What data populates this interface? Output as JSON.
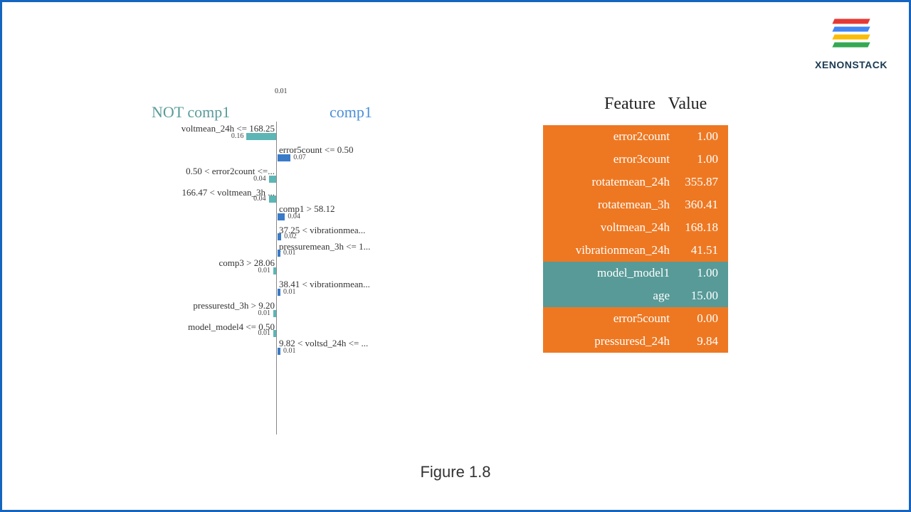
{
  "brand": "XENONSTACK",
  "caption": "Figure 1.8",
  "lime": {
    "tick_top": "0.01",
    "class_not": "NOT comp1",
    "class_yes": "comp1",
    "scale": 260,
    "bars": [
      {
        "side": "left",
        "label": "voltmean_24h <= 168.25",
        "value": 0.16,
        "text": "0.16"
      },
      {
        "side": "right",
        "label": "error5count <= 0.50",
        "value": 0.07,
        "text": "0.07"
      },
      {
        "side": "left",
        "label": "0.50 < error2count <=...",
        "value": 0.04,
        "text": "0.04"
      },
      {
        "side": "left",
        "label": "166.47 < voltmean_3h ...",
        "value": 0.04,
        "text": "0.04",
        "compact": true
      },
      {
        "side": "right",
        "label": "comp1 > 58.12",
        "value": 0.04,
        "text": "0.04"
      },
      {
        "side": "right",
        "label": "37.25 < vibrationmea...",
        "value": 0.02,
        "text": "0.02",
        "compact": true
      },
      {
        "side": "right",
        "label": "pressuremean_3h <= 1...",
        "value": 0.01,
        "text": "0.01",
        "compact": true
      },
      {
        "side": "left",
        "label": "comp3 > 28.06",
        "value": 0.01,
        "text": "0.01"
      },
      {
        "side": "right",
        "label": "38.41 < vibrationmean...",
        "value": 0.01,
        "text": "0.01"
      },
      {
        "side": "left",
        "label": "pressurestd_3h > 9.20",
        "value": 0.01,
        "text": "0.01"
      },
      {
        "side": "left",
        "label": "model_model4 <= 0.50",
        "value": 0.01,
        "text": "0.01",
        "compact": true
      },
      {
        "side": "right",
        "label": "9.82 < voltsd_24h <= ...",
        "value": 0.01,
        "text": "0.01"
      }
    ]
  },
  "table": {
    "header_feature": "Feature",
    "header_value": "Value",
    "rows": [
      {
        "feature": "error2count",
        "value": "1.00",
        "style": "orange"
      },
      {
        "feature": "error3count",
        "value": "1.00",
        "style": "orange"
      },
      {
        "feature": "rotatemean_24h",
        "value": "355.87",
        "style": "orange"
      },
      {
        "feature": "rotatemean_3h",
        "value": "360.41",
        "style": "orange"
      },
      {
        "feature": "voltmean_24h",
        "value": "168.18",
        "style": "orange"
      },
      {
        "feature": "vibrationmean_24h",
        "value": "41.51",
        "style": "orange"
      },
      {
        "feature": "model_model1",
        "value": "1.00",
        "style": "teal"
      },
      {
        "feature": "age",
        "value": "15.00",
        "style": "teal"
      },
      {
        "feature": "error5count",
        "value": "0.00",
        "style": "orange"
      },
      {
        "feature": "pressuresd_24h",
        "value": "9.84",
        "style": "orange"
      }
    ]
  }
}
